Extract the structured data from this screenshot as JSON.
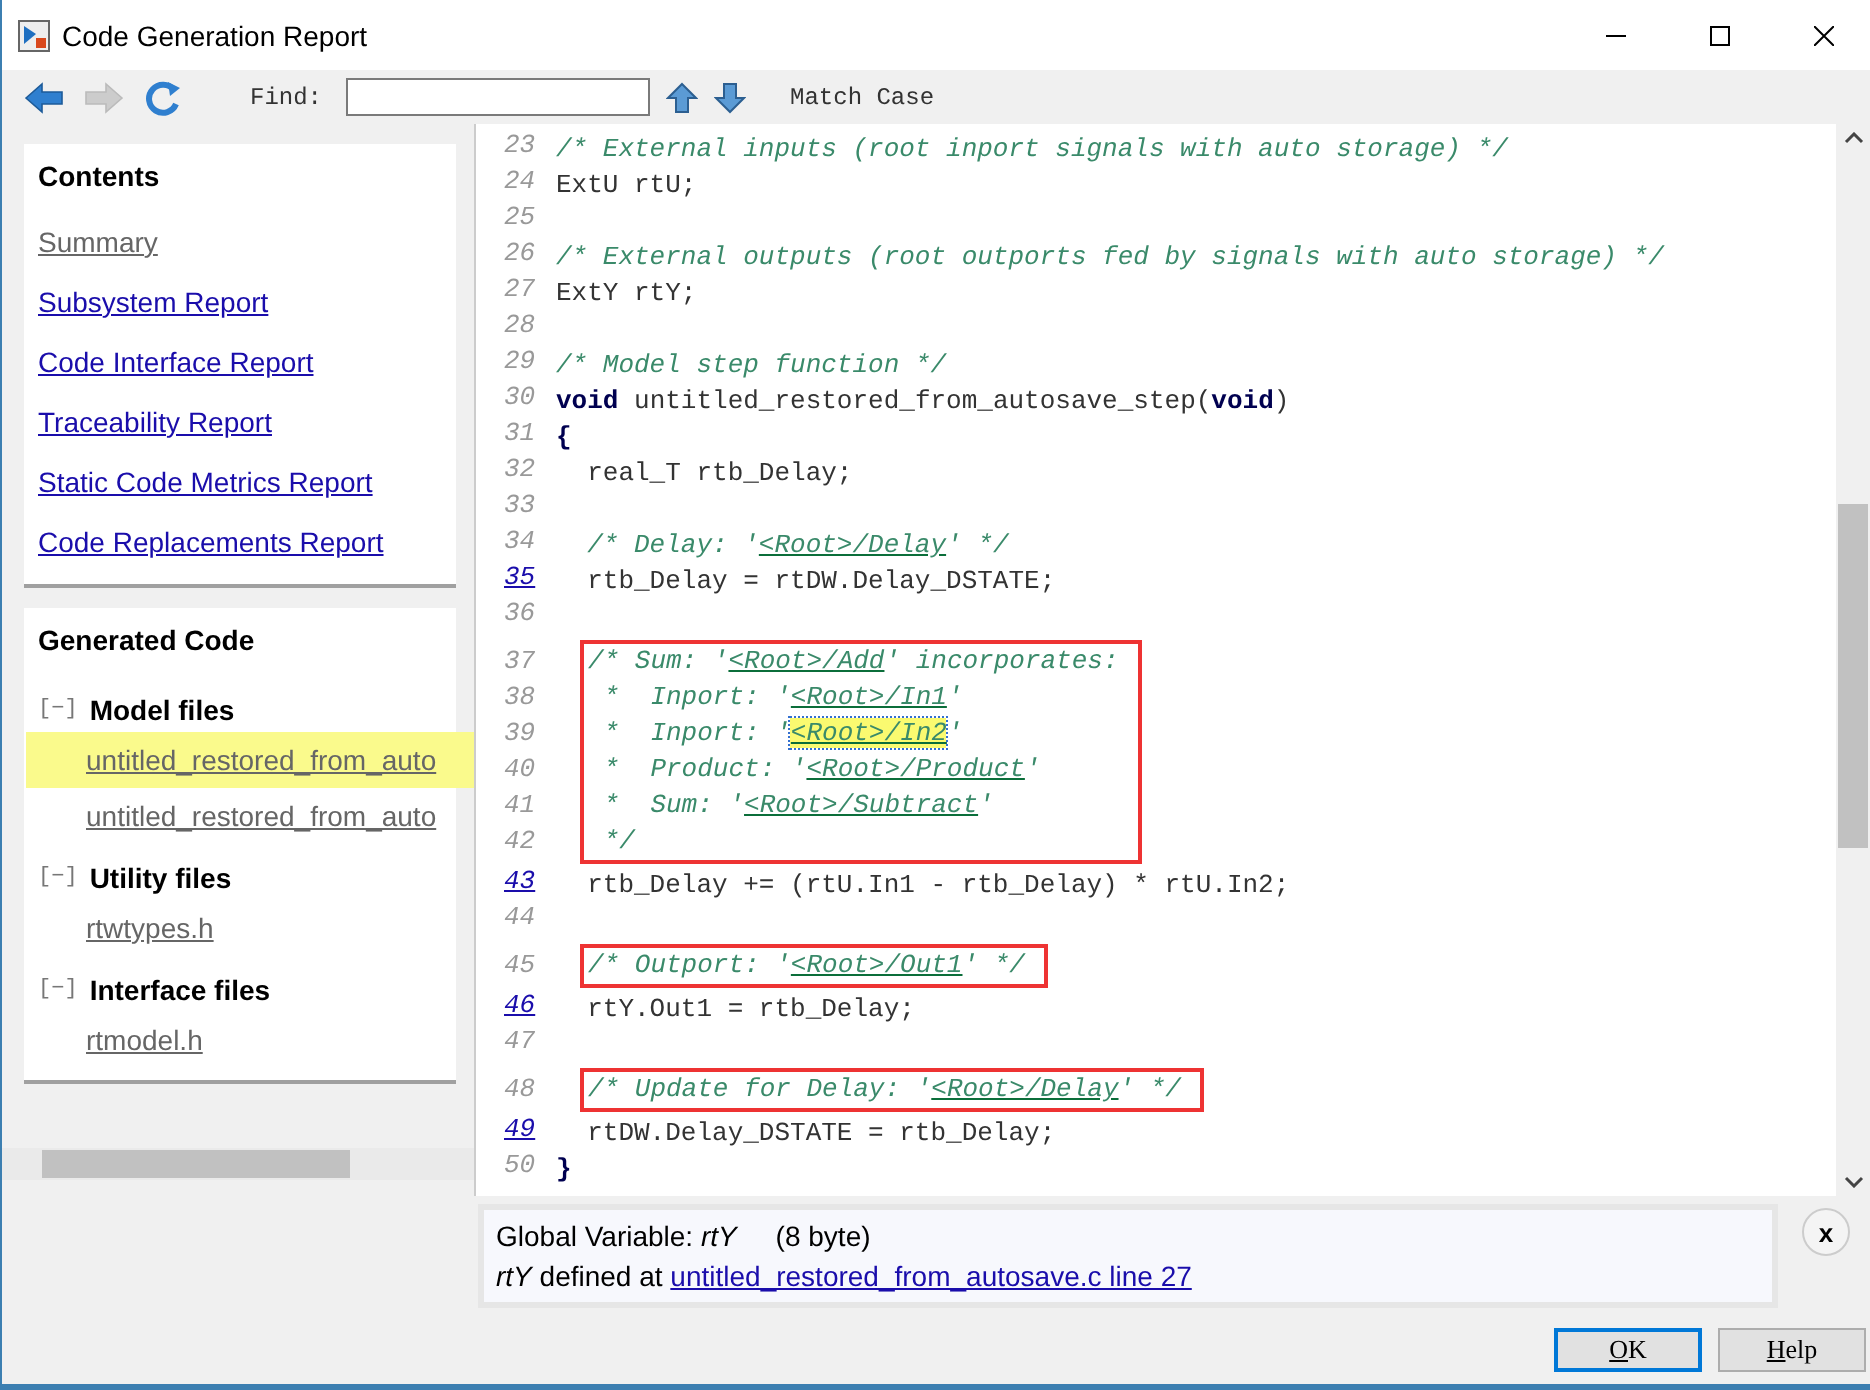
{
  "window": {
    "title": "Code Generation Report"
  },
  "toolbar": {
    "buttons": [
      {
        "kind": "back",
        "disabled": false
      },
      {
        "kind": "forward",
        "disabled": true
      },
      {
        "kind": "refresh",
        "disabled": false
      }
    ],
    "find_label": "Find:",
    "search_buttons": [
      {
        "kind": "up"
      },
      {
        "kind": "down"
      }
    ],
    "match_case": "Match Case"
  },
  "contents": {
    "title": "Contents",
    "items": [
      {
        "label": "Summary",
        "visited": true
      },
      {
        "label": "Subsystem Report",
        "visited": false
      },
      {
        "label": "Code Interface Report",
        "visited": false
      },
      {
        "label": "Traceability Report",
        "visited": false
      },
      {
        "label": "Static Code Metrics Report",
        "visited": false
      },
      {
        "label": "Code Replacements Report",
        "visited": false
      }
    ]
  },
  "generated_code": {
    "title": "Generated Code",
    "groups": [
      {
        "toggle": "[−]",
        "label": "Model files",
        "files": [
          {
            "name": "untitled_restored_from_auto",
            "selected": true
          },
          {
            "name": "untitled_restored_from_auto",
            "selected": false
          }
        ]
      },
      {
        "toggle": "[−]",
        "label": "Utility files",
        "files": [
          {
            "name": "rtwtypes.h",
            "selected": false
          }
        ]
      },
      {
        "toggle": "[−]",
        "label": "Interface files",
        "files": [
          {
            "name": "rtmodel.h",
            "selected": false
          }
        ]
      }
    ]
  },
  "code": {
    "blocks": [
      {
        "boxed": false,
        "lines": [
          {
            "number": "23",
            "linked": false,
            "parts": [
              {
                "kind": "comment",
                "text": "/* External inputs (root inport signals with auto storage) */"
              }
            ]
          },
          {
            "number": "24",
            "linked": false,
            "parts": [
              {
                "kind": "plain",
                "text": "ExtU rtU;"
              }
            ]
          },
          {
            "number": "25",
            "linked": false
          },
          {
            "number": "26",
            "linked": false,
            "parts": [
              {
                "kind": "comment",
                "text": "/* External outputs (root outports fed by signals with auto storage) */"
              }
            ]
          },
          {
            "number": "27",
            "linked": false,
            "parts": [
              {
                "kind": "plain",
                "text": "ExtY rtY;"
              }
            ]
          },
          {
            "number": "28",
            "linked": false
          },
          {
            "number": "29",
            "linked": false,
            "parts": [
              {
                "kind": "comment",
                "text": "/* Model step function */"
              }
            ]
          },
          {
            "number": "30",
            "linked": false,
            "parts": [
              {
                "kind": "keyword",
                "text": "void"
              },
              {
                "kind": "plain",
                "text": " untitled_restored_from_autosave_step("
              },
              {
                "kind": "keyword",
                "text": "void"
              },
              {
                "kind": "plain",
                "text": ")"
              }
            ]
          },
          {
            "number": "31",
            "linked": false,
            "parts": [
              {
                "kind": "keyword",
                "text": "{"
              }
            ]
          },
          {
            "number": "32",
            "linked": false,
            "parts": [
              {
                "kind": "plain",
                "text": "  real_T rtb_Delay;"
              }
            ]
          },
          {
            "number": "33",
            "linked": false
          },
          {
            "number": "34",
            "linked": false,
            "parts": [
              {
                "kind": "comment",
                "text": "  /* Delay: '"
              },
              {
                "kind": "link",
                "text": "<Root>/Delay",
                "highlighted": false
              },
              {
                "kind": "comment",
                "text": "' */"
              }
            ]
          },
          {
            "number": "35",
            "linked": true,
            "parts": [
              {
                "kind": "plain",
                "text": "  rtb_Delay = rtDW.Delay_DSTATE;"
              }
            ]
          },
          {
            "number": "36",
            "linked": false
          }
        ]
      },
      {
        "boxed": true,
        "lines": [
          {
            "number": "37",
            "linked": false,
            "parts": [
              {
                "kind": "comment",
                "text": "/* Sum: '"
              },
              {
                "kind": "link",
                "text": "<Root>/Add",
                "highlighted": false
              },
              {
                "kind": "comment",
                "text": "' incorporates:"
              }
            ]
          },
          {
            "number": "38",
            "linked": false,
            "parts": [
              {
                "kind": "comment",
                "text": " *  Inport: '"
              },
              {
                "kind": "link",
                "text": "<Root>/In1",
                "highlighted": false
              },
              {
                "kind": "comment",
                "text": "'"
              }
            ]
          },
          {
            "number": "39",
            "linked": false,
            "parts": [
              {
                "kind": "comment",
                "text": " *  Inport: '"
              },
              {
                "kind": "link",
                "text": "<Root>/In2",
                "highlighted": true
              },
              {
                "kind": "comment",
                "text": "'"
              }
            ]
          },
          {
            "number": "40",
            "linked": false,
            "parts": [
              {
                "kind": "comment",
                "text": " *  Product: '"
              },
              {
                "kind": "link",
                "text": "<Root>/Product",
                "highlighted": false
              },
              {
                "kind": "comment",
                "text": "'"
              }
            ]
          },
          {
            "number": "41",
            "linked": false,
            "parts": [
              {
                "kind": "comment",
                "text": " *  Sum: '"
              },
              {
                "kind": "link",
                "text": "<Root>/Subtract",
                "highlighted": false
              },
              {
                "kind": "comment",
                "text": "'"
              }
            ]
          },
          {
            "number": "42",
            "linked": false,
            "parts": [
              {
                "kind": "comment",
                "text": " */"
              }
            ]
          }
        ]
      },
      {
        "boxed": false,
        "lines": [
          {
            "number": "43",
            "linked": true,
            "parts": [
              {
                "kind": "plain",
                "text": "  rtb_Delay += (rtU.In1 - rtb_Delay) * rtU.In2;"
              }
            ]
          },
          {
            "number": "44",
            "linked": false
          }
        ]
      },
      {
        "boxed": true,
        "lines": [
          {
            "number": "45",
            "linked": false,
            "parts": [
              {
                "kind": "comment",
                "text": "/* Outport: '"
              },
              {
                "kind": "link",
                "text": "<Root>/Out1",
                "highlighted": false
              },
              {
                "kind": "comment",
                "text": "' */"
              }
            ]
          }
        ]
      },
      {
        "boxed": false,
        "lines": [
          {
            "number": "46",
            "linked": true,
            "parts": [
              {
                "kind": "plain",
                "text": "  rtY.Out1 = rtb_Delay;"
              }
            ]
          },
          {
            "number": "47",
            "linked": false
          }
        ]
      },
      {
        "boxed": true,
        "lines": [
          {
            "number": "48",
            "linked": false,
            "parts": [
              {
                "kind": "comment",
                "text": "/* Update for Delay: '"
              },
              {
                "kind": "link",
                "text": "<Root>/Delay",
                "highlighted": false
              },
              {
                "kind": "comment",
                "text": "' */"
              }
            ]
          }
        ]
      },
      {
        "boxed": false,
        "lines": [
          {
            "number": "49",
            "linked": true,
            "parts": [
              {
                "kind": "plain",
                "text": "  rtDW.Delay_DSTATE = rtb_Delay;"
              }
            ]
          },
          {
            "number": "50",
            "linked": false,
            "parts": [
              {
                "kind": "keyword",
                "text": "}"
              }
            ]
          }
        ]
      }
    ]
  },
  "info": {
    "heading": "Global Variable: *rtY*     (8 byte)",
    "definition": "*rtY* defined at ",
    "link": "untitled_restored_from_autosave.c line 27",
    "close": "x"
  },
  "buttons": [
    {
      "label": "OK",
      "default": true
    },
    {
      "label": "Help",
      "default": false
    }
  ]
}
